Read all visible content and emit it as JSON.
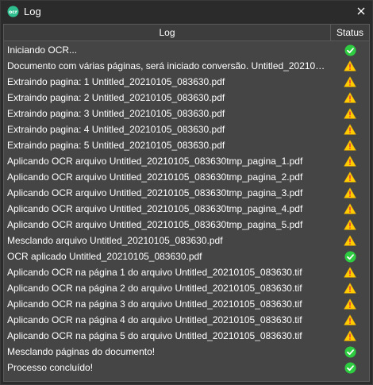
{
  "window": {
    "title": "Log"
  },
  "table": {
    "columns": {
      "log": "Log",
      "status": "Status"
    },
    "rows": [
      {
        "message": "Iniciando OCR...",
        "status": "success"
      },
      {
        "message": "Documento com várias páginas, será iniciado conversão. Untitled_20210105_083630.pdf",
        "status": "warning"
      },
      {
        "message": "Extraindo pagina: 1 Untitled_20210105_083630.pdf",
        "status": "warning"
      },
      {
        "message": "Extraindo pagina: 2 Untitled_20210105_083630.pdf",
        "status": "warning"
      },
      {
        "message": "Extraindo pagina: 3 Untitled_20210105_083630.pdf",
        "status": "warning"
      },
      {
        "message": "Extraindo pagina: 4 Untitled_20210105_083630.pdf",
        "status": "warning"
      },
      {
        "message": "Extraindo pagina: 5 Untitled_20210105_083630.pdf",
        "status": "warning"
      },
      {
        "message": "Aplicando OCR arquivo Untitled_20210105_083630tmp_pagina_1.pdf",
        "status": "warning"
      },
      {
        "message": "Aplicando OCR arquivo Untitled_20210105_083630tmp_pagina_2.pdf",
        "status": "warning"
      },
      {
        "message": "Aplicando OCR arquivo Untitled_20210105_083630tmp_pagina_3.pdf",
        "status": "warning"
      },
      {
        "message": "Aplicando OCR arquivo Untitled_20210105_083630tmp_pagina_4.pdf",
        "status": "warning"
      },
      {
        "message": "Aplicando OCR arquivo Untitled_20210105_083630tmp_pagina_5.pdf",
        "status": "warning"
      },
      {
        "message": "Mesclando arquivo Untitled_20210105_083630.pdf",
        "status": "warning"
      },
      {
        "message": "OCR aplicado Untitled_20210105_083630.pdf",
        "status": "success"
      },
      {
        "message": "Aplicando OCR na página 1 do arquivo Untitled_20210105_083630.tif",
        "status": "warning"
      },
      {
        "message": "Aplicando OCR na página 2 do arquivo Untitled_20210105_083630.tif",
        "status": "warning"
      },
      {
        "message": "Aplicando OCR na página 3 do arquivo Untitled_20210105_083630.tif",
        "status": "warning"
      },
      {
        "message": "Aplicando OCR na página 4 do arquivo Untitled_20210105_083630.tif",
        "status": "warning"
      },
      {
        "message": "Aplicando OCR na página 5 do arquivo Untitled_20210105_083630.tif",
        "status": "warning"
      },
      {
        "message": "Mesclando páginas do documento!",
        "status": "success"
      },
      {
        "message": "Processo concluído!",
        "status": "success"
      }
    ]
  },
  "colors": {
    "success": "#2ecc40",
    "warning": "#ffcc00",
    "warning_mark": "#e53935",
    "app_icon": "#2fbf8f"
  },
  "icons": {
    "app": "app-logo-icon",
    "close": "close-icon",
    "success": "check-circle-icon",
    "warning": "warning-triangle-icon"
  }
}
